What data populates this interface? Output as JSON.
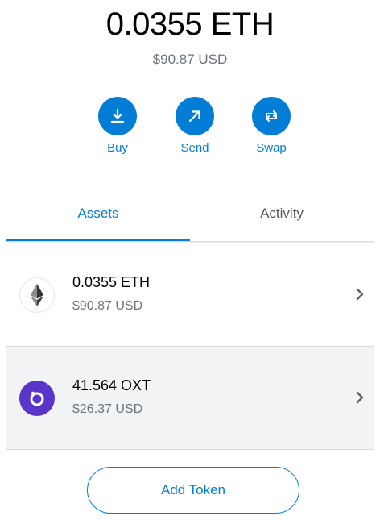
{
  "balance": {
    "primary": "0.0355 ETH",
    "secondary": "$90.87 USD"
  },
  "actions": [
    {
      "label": "Buy",
      "icon": "download-icon"
    },
    {
      "label": "Send",
      "icon": "arrow-up-right-icon"
    },
    {
      "label": "Swap",
      "icon": "swap-icon"
    }
  ],
  "tabs": {
    "assets": "Assets",
    "activity": "Activity",
    "active": "Assets"
  },
  "assets": [
    {
      "amount": "0.0355 ETH",
      "fiat": "$90.87 USD",
      "icon": "ethereum-icon"
    },
    {
      "amount": "41.564 OXT",
      "fiat": "$26.37 USD",
      "icon": "orchid-icon"
    }
  ],
  "add_token": "Add Token",
  "colors": {
    "accent": "#037dd6",
    "oxt_brand": "#5b34c9",
    "muted_text": "#6a737d"
  }
}
